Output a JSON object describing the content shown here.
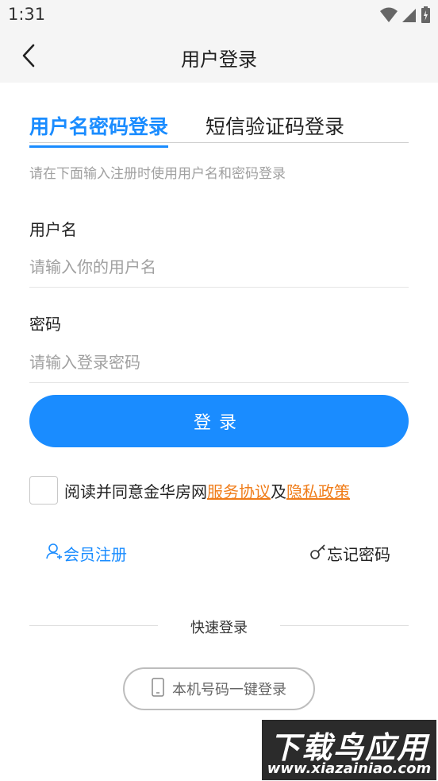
{
  "status_bar": {
    "time": "1:31"
  },
  "header": {
    "title": "用户登录",
    "back_icon": "back-arrow-icon"
  },
  "tabs": [
    {
      "label": "用户名密码登录",
      "active": true
    },
    {
      "label": "短信验证码登录",
      "active": false
    }
  ],
  "hint": "请在下面输入注册时使用用户名和密码登录",
  "form": {
    "username_label": "用户名",
    "username_placeholder": "请输入你的用户名",
    "username_value": "",
    "password_label": "密码",
    "password_placeholder": "请输入登录密码",
    "password_value": ""
  },
  "login_button": "登录",
  "agreement": {
    "checked": false,
    "text": "阅读并同意金华房网",
    "service_link": "服务协议",
    "and": "及",
    "privacy_link": "隐私政策"
  },
  "links": {
    "register": "会员注册",
    "forgot": "忘记密码"
  },
  "quick_login": {
    "label": "快速登录",
    "onekey": "本机号码一键登录"
  },
  "watermark": {
    "main": "下载鸟应用",
    "url": "www.xiazainiao.com"
  },
  "colors": {
    "accent": "#1a8cff",
    "link_orange": "#f07d1a",
    "hint_gray": "#a0a0a0"
  }
}
